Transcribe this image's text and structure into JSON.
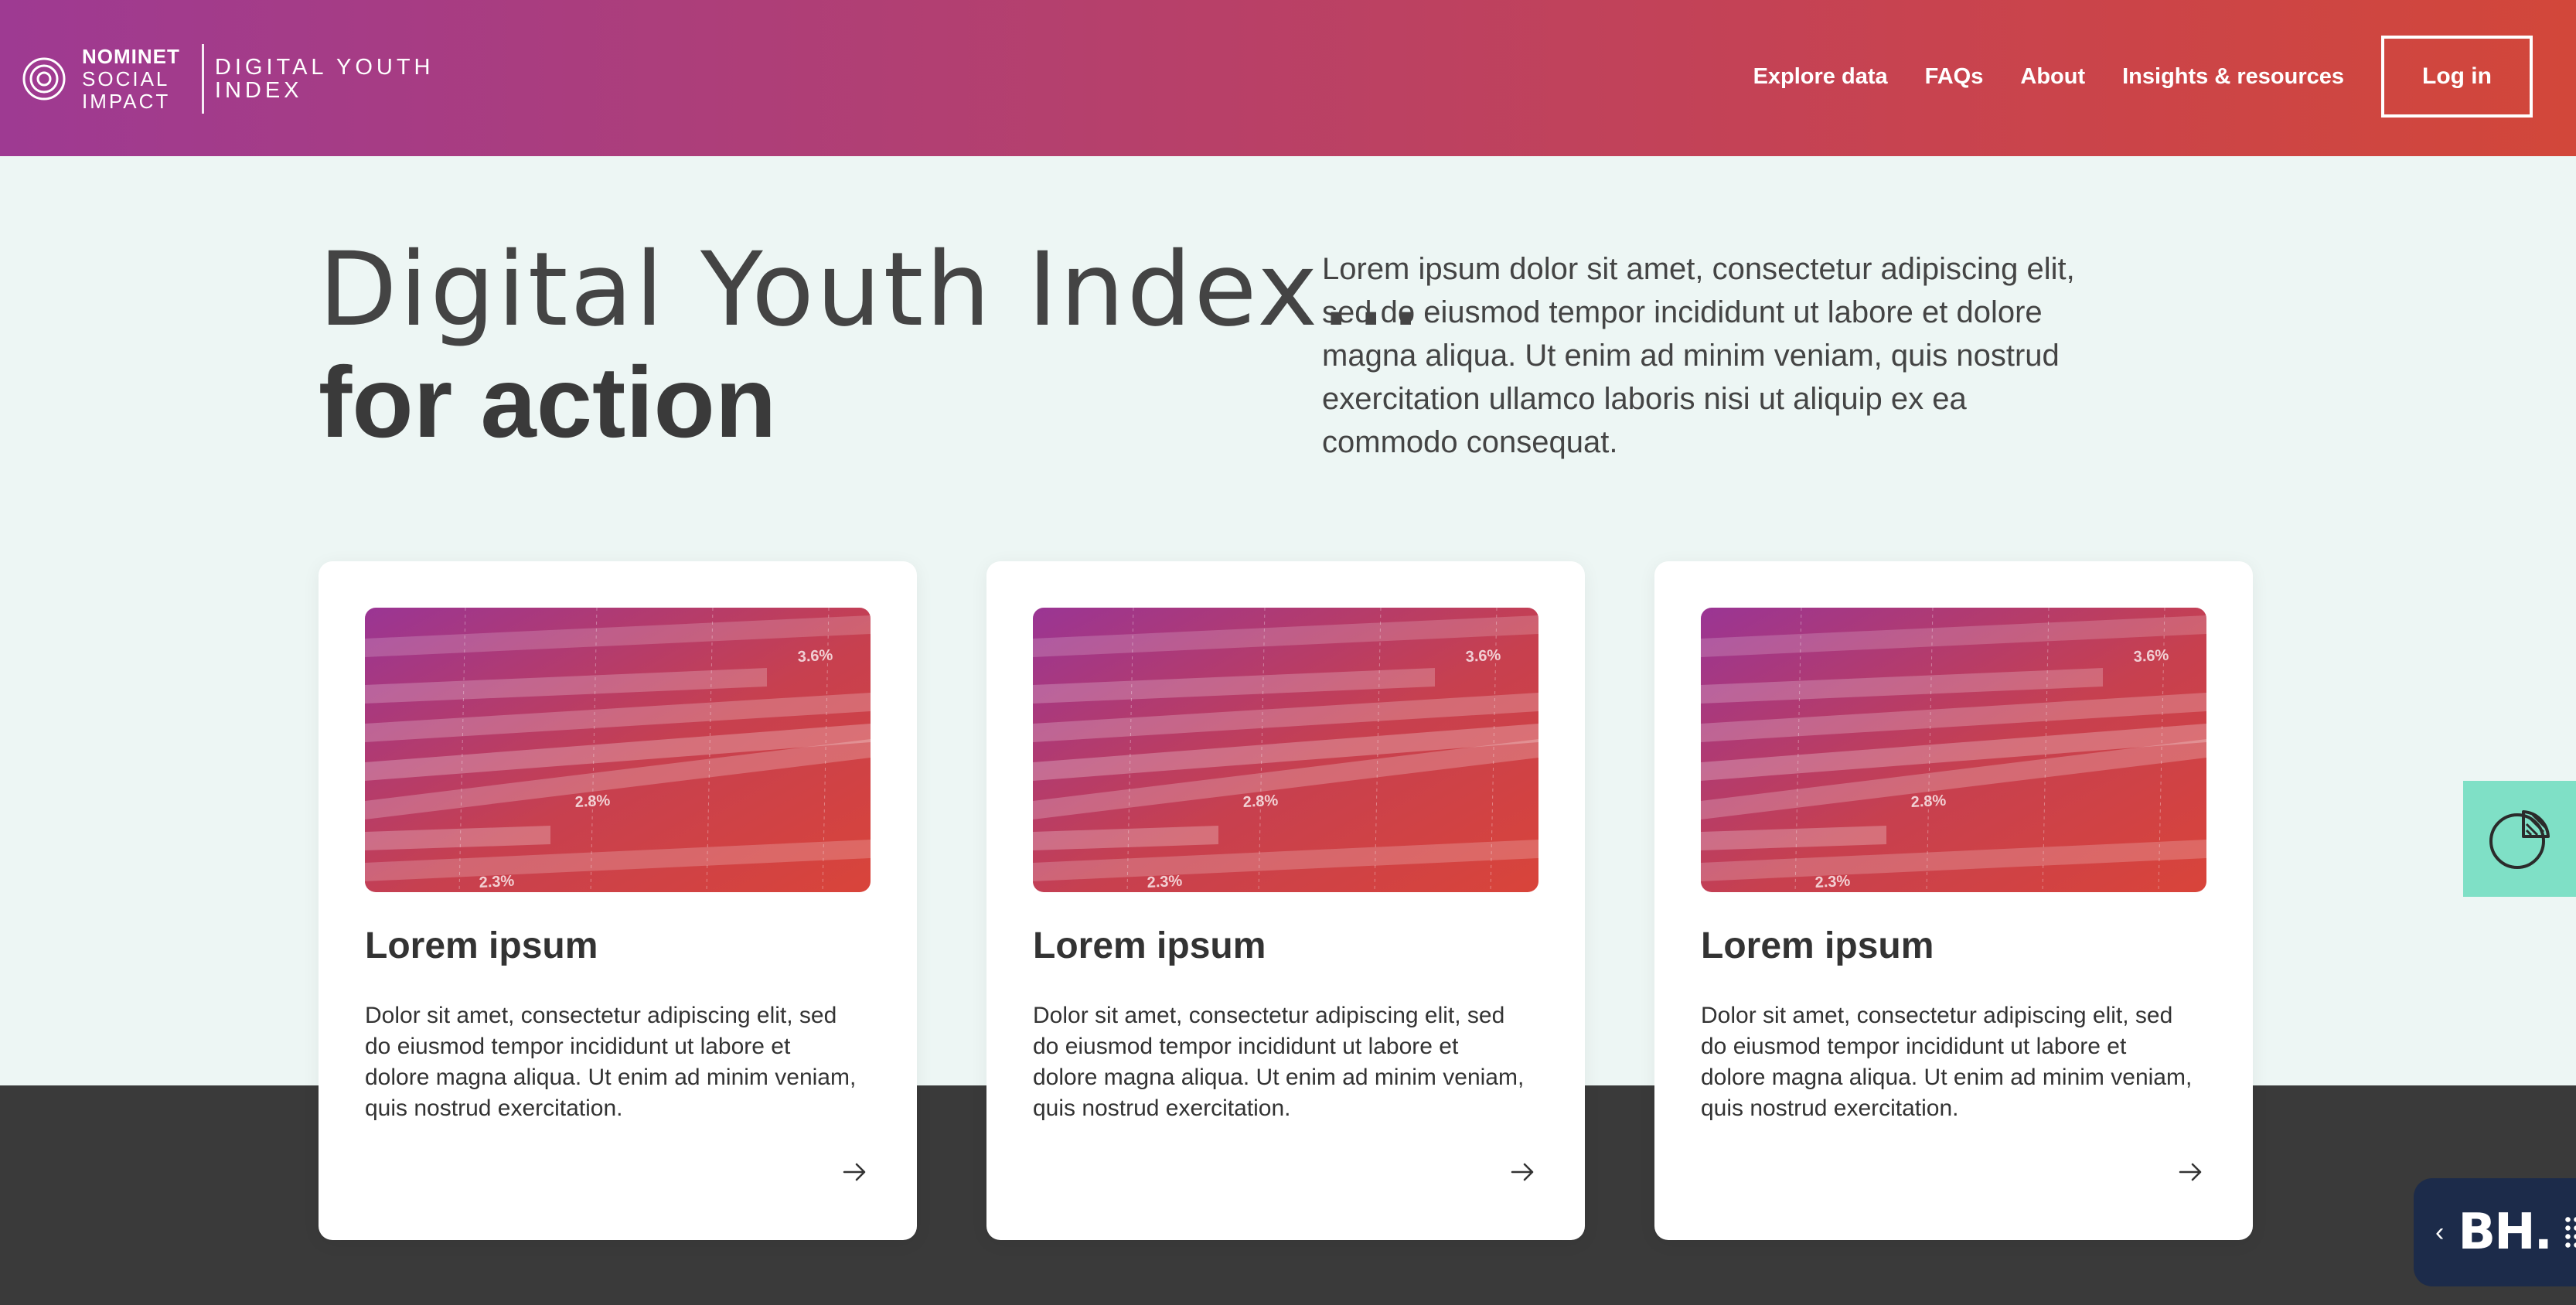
{
  "header": {
    "logo": {
      "line1": "NOMINET",
      "line2": "SOCIAL",
      "line3": "IMPACT",
      "sub1": "DIGITAL YOUTH",
      "sub2": "INDEX"
    },
    "nav": [
      "Explore data",
      "FAQs",
      "About",
      "Insights & resources"
    ],
    "login_label": "Log in",
    "gradient": [
      "#9e3a92",
      "#d2473a"
    ]
  },
  "hero": {
    "title_light": "Digital Youth Index...",
    "title_bold": "for action",
    "description": "Lorem ipsum dolor sit amet, consectetur adipiscing elit, sed do eiusmod tempor incididunt ut labore et dolore magna aliqua. Ut enim ad minim veniam, quis nostrud exercitation ullamco laboris nisi ut aliquip ex ea commodo consequat."
  },
  "cards": [
    {
      "title": "Lorem ipsum",
      "text": "Dolor sit amet, consectetur adipiscing elit, sed do eiusmod tempor incididunt ut labore et dolore magna aliqua. Ut enim ad minim veniam, quis nostrud exercitation.",
      "image_labels": [
        "3.6%",
        "2.8%",
        "2.3%"
      ],
      "icon": "arrow-right-icon"
    },
    {
      "title": "Lorem ipsum",
      "text": "Dolor sit amet, consectetur adipiscing elit, sed do eiusmod tempor incididunt ut labore et dolore magna aliqua. Ut enim ad minim veniam, quis nostrud exercitation.",
      "image_labels": [
        "3.6%",
        "2.8%",
        "2.3%"
      ],
      "icon": "arrow-right-icon"
    },
    {
      "title": "Lorem ipsum",
      "text": "Dolor sit amet, consectetur adipiscing elit, sed do eiusmod tempor incididunt ut labore et dolore magna aliqua. Ut enim ad minim veniam, quis nostrud exercitation.",
      "image_labels": [
        "3.6%",
        "2.8%",
        "2.3%"
      ],
      "icon": "arrow-right-icon"
    }
  ],
  "widgets": {
    "chart_button_icon": "pie-chart-icon",
    "bh_label": "BH.",
    "bh_chevron": "‹"
  },
  "colors": {
    "page_bg": "#edf6f4",
    "dark_band": "#3a3a3a",
    "chart_button": "#7fe0c6",
    "bh_widget": "#1c2b4a"
  }
}
